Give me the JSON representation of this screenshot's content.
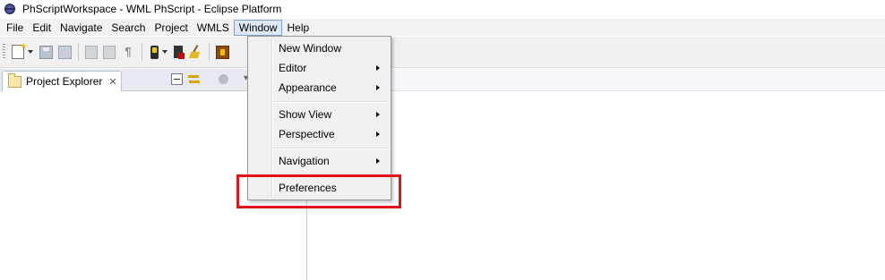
{
  "window": {
    "title": "PhScriptWorkspace - WML PhScript - Eclipse Platform"
  },
  "menubar": {
    "items": [
      "File",
      "Edit",
      "Navigate",
      "Search",
      "Project",
      "WMLS",
      "Window",
      "Help"
    ],
    "active": "Window"
  },
  "toolbar": {
    "icons": [
      "new-wizard-icon",
      "save-icon",
      "save-all-icon",
      "print-icon",
      "properties-icon",
      "paragraph-icon",
      "device-icon",
      "device-error-icon",
      "clean-icon",
      "package-icon"
    ]
  },
  "explorer": {
    "tab_label": "Project Explorer",
    "close_glyph": "✕"
  },
  "window_menu": {
    "items": [
      {
        "label": "New Window",
        "submenu": false
      },
      {
        "label": "Editor",
        "submenu": true
      },
      {
        "label": "Appearance",
        "submenu": true
      },
      {
        "label": "Show View",
        "submenu": true
      },
      {
        "label": "Perspective",
        "submenu": true
      },
      {
        "label": "Navigation",
        "submenu": true
      },
      {
        "label": "Preferences",
        "submenu": false
      }
    ],
    "highlighted": "Preferences",
    "highlight_color": "#e3131b"
  }
}
